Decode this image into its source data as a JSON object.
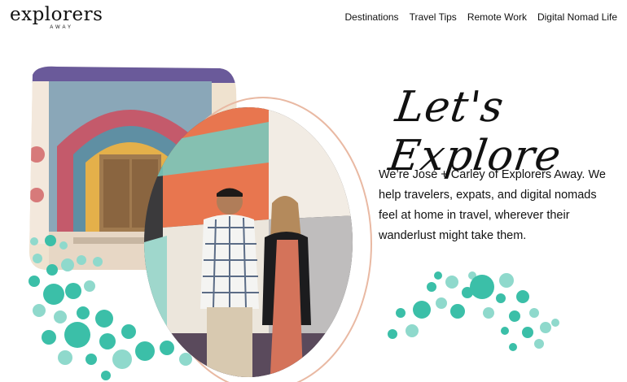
{
  "brand": {
    "name": "explorers",
    "tagline": "AWAY"
  },
  "nav": {
    "items": [
      {
        "label": "Destinations"
      },
      {
        "label": "Travel Tips"
      },
      {
        "label": "Remote Work"
      },
      {
        "label": "Digital Nomad Life"
      }
    ]
  },
  "hero": {
    "title": "Let's Explore",
    "intro": "We’re José + Carley of Explorers Away. We help travelers, expats, and digital nomads feel at home in travel, wherever their wanderlust might take them."
  },
  "colors": {
    "accent_teal": "#3bbfa8",
    "light_teal": "#8fd9cc",
    "peach": "#e9b9a3",
    "coral": "#e8764f"
  }
}
